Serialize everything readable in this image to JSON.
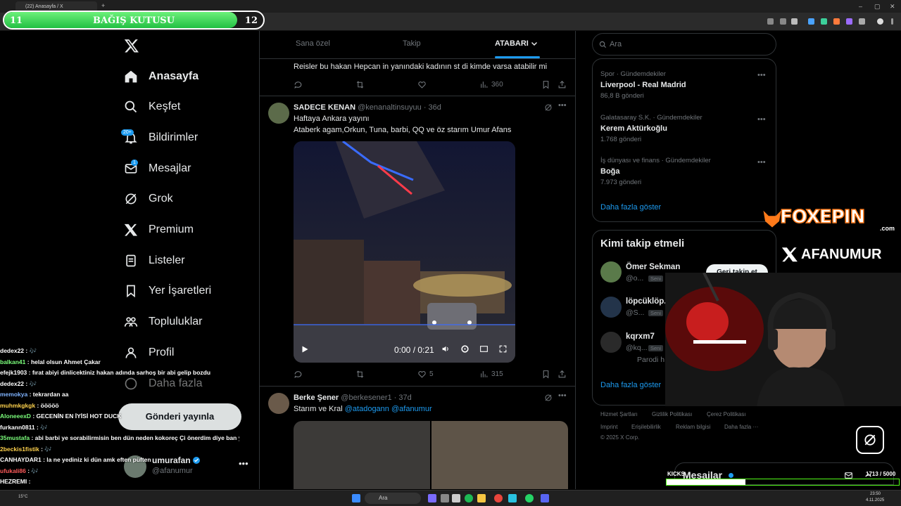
{
  "browser": {
    "tab_title": "(22) Anasayfa / X",
    "new_tab": "+",
    "window_controls": [
      "–",
      "▢",
      "✕"
    ]
  },
  "donation": {
    "title": "BAĞIŞ KUTUSU",
    "left": "11",
    "right": "12",
    "progress": 0.9
  },
  "sidebar": {
    "items": [
      {
        "label": "Anasayfa",
        "icon": "home-icon"
      },
      {
        "label": "Keşfet",
        "icon": "search-icon"
      },
      {
        "label": "Bildirimler",
        "icon": "bell-icon",
        "badge": "20+"
      },
      {
        "label": "Mesajlar",
        "icon": "mail-icon",
        "badge": "1"
      },
      {
        "label": "Grok",
        "icon": "grok-icon"
      },
      {
        "label": "Premium",
        "icon": "x-logo-icon"
      },
      {
        "label": "Listeler",
        "icon": "list-icon"
      },
      {
        "label": "Yer İşaretleri",
        "icon": "bookmark-icon"
      },
      {
        "label": "Topluluklar",
        "icon": "people-icon"
      },
      {
        "label": "Profil",
        "icon": "person-icon"
      },
      {
        "label": "Daha fazla",
        "icon": "more-circle-icon"
      }
    ],
    "post_button": "Gönderi yayınla",
    "account": {
      "name": "umurafan",
      "handle": "@afanumur"
    }
  },
  "chat": [
    {
      "user": "dedex22",
      "color": "#ffffff",
      "msg": ": 🎶"
    },
    {
      "user": "balkan41",
      "color": "#7cff7c",
      "msg": ": helal olsun Ahmet Çakar"
    },
    {
      "user": "efejk1903",
      "color": "#ffffff",
      "msg": ": fırat abiyi dinlicektiniz hakan adında sarhoş bir abi gelip bozdu"
    },
    {
      "user": "dedex22",
      "color": "#ffffff",
      "msg": ": 🎶"
    },
    {
      "user": "memokya",
      "color": "#7fb3ff",
      "msg": ": tekrardan aa"
    },
    {
      "user": "muhmkgkgk",
      "color": "#ffd24d",
      "msg": ": ööööö"
    },
    {
      "user": "AloneeexD",
      "color": "#7cff7c",
      "msg": ": GECENİN EN İYİSİ HOT DUCK"
    },
    {
      "user": "furkann0811",
      "color": "#ffffff",
      "msg": ": 🎶"
    },
    {
      "user": "35mustafa",
      "color": "#7cff7c",
      "msg": ": abi barbi ye sorabilirmisin ben dün neden kokoreç Çi önerdim diye ban yedin yaaa"
    },
    {
      "user": "2beckis1fistik",
      "color": "#ffd24d",
      "msg": ": 🎶"
    },
    {
      "user": "CANHAYDAR1",
      "color": "#ffffff",
      "msg": ": la ne yediniz ki dün amk eften püften"
    },
    {
      "user": "ufukali86",
      "color": "#ff5a5a",
      "msg": ": 🎶"
    },
    {
      "user": "HEZREMI",
      "color": "#ffffff",
      "msg": ":"
    }
  ],
  "timeline": {
    "tabs": [
      "Sana özel",
      "Takip",
      "ATABARI"
    ],
    "posts": [
      {
        "text": "Reisler bu hakan Hepcan in yanındaki kadının st di kimde varsa atabilir mi",
        "views": "360"
      },
      {
        "name": "SADECE KENAN",
        "handle": "@kenanaltinsuyuu",
        "time": "· 36d",
        "line1": "Haftaya Ankara yayını",
        "line2": "Ataberk agam,Orkun, Tuna, barbi, QQ ve öz starım Umur Afans",
        "video_time": "0:00 / 0:21",
        "likes": "5",
        "views": "315"
      },
      {
        "name": "Berke Şener",
        "handle": "@berkesener1",
        "time": "· 37d",
        "text": "Starım ve Kral",
        "mention1": "@atadogann",
        "mention2": "@afanumur"
      }
    ]
  },
  "right": {
    "search_placeholder": "Ara",
    "trends": [
      {
        "category": "Spor · Gündemdekiler",
        "name": "Liverpool - Real Madrid",
        "count": "86,8 B gönderi"
      },
      {
        "category": "Galatasaray S.K. · Gündemdekiler",
        "name": "Kerem Aktürkoğlu",
        "count": "1.768 gönderi"
      },
      {
        "category": "İş dünyası ve finans · Gündemdekiler",
        "name": "Boğa",
        "count": "7.973 gönderi"
      }
    ],
    "show_more": "Daha fazla göster",
    "follow_title": "Kimi takip etmeli",
    "follow": [
      {
        "name": "Ömer Sekman",
        "handle": "@o...",
        "tag": "Seni"
      },
      {
        "name": "löpcüklöp...",
        "handle": "@S...",
        "tag": "Seni"
      },
      {
        "name": "kqrxm7",
        "handle": "@kq...",
        "tag": "Seni",
        "extra": "Parodi h"
      }
    ],
    "follow_button": "Geri takip et",
    "footer": [
      "Hizmet Şartları",
      "Gizlilik Politikası",
      "Çerez Politikası",
      "Imprint",
      "Erişilebilirlik",
      "Reklam bilgisi",
      "Daha fazla ···",
      "© 2025 X Corp."
    ]
  },
  "overlay": {
    "foxepin": "FOXEPIN",
    "foxepin_sub": ".com",
    "afanumur": "AFANUMUR",
    "kick_label": "KICKS",
    "kick_count": "1713 / 5000",
    "kick_progress": 0.34,
    "messages": "Mesajlar"
  },
  "taskbar": {
    "weather": "15°C",
    "search": "Ara",
    "time": "23:50",
    "date": "4.11.2025"
  }
}
